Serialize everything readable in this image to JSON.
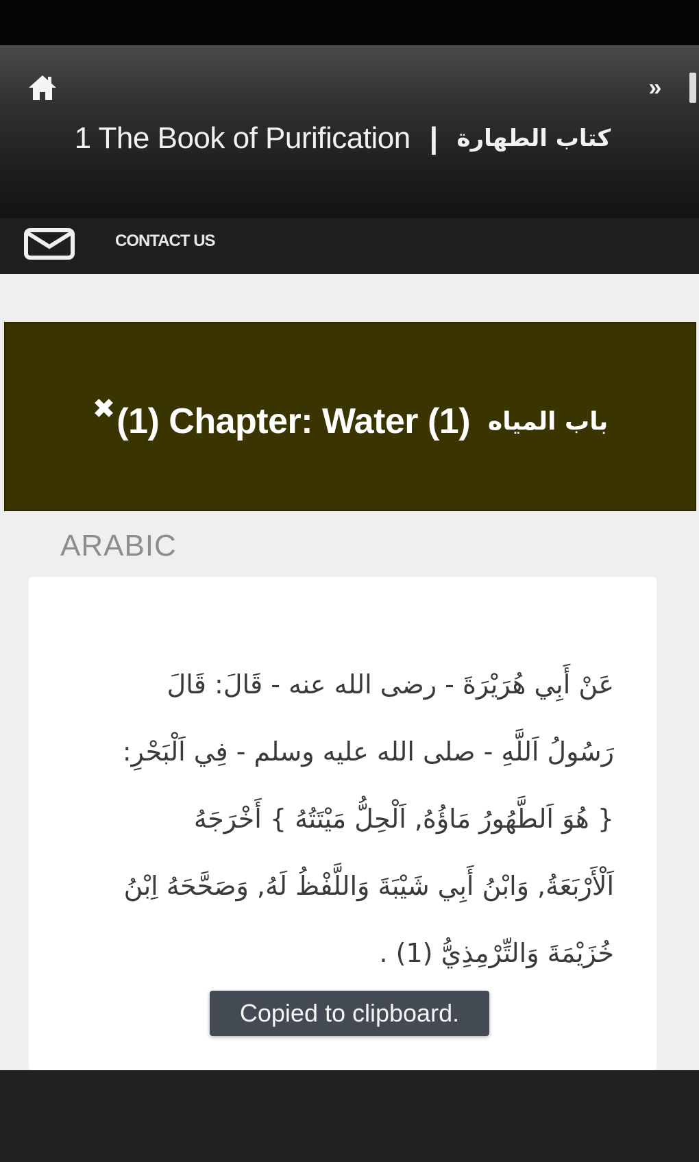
{
  "header": {
    "title_en": "1 The Book of Purification",
    "divider": "|",
    "title_ar": "كتاب الطهارة",
    "next_glyph": "»"
  },
  "contact": {
    "label": "CONTACT US"
  },
  "chapter": {
    "close_glyph": "✖",
    "title_en": "(1) Chapter: Water (1)",
    "title_ar": "باب المياه"
  },
  "section": {
    "label": "ARABIC"
  },
  "hadith": {
    "text": "عَنْ أَبِي هُرَيْرَةَ - رضى الله عنه - قَالَ: قَالَ رَسُولُ اَللَّهِ - صلى الله عليه وسلم - فِي اَلْبَحْرِ: { هُوَ اَلطَّهُورُ مَاؤُهُ, اَلْحِلُّ مَيْتَتُهُ } أَخْرَجَهُ اَلْأَرْبَعَةُ, وَابْنُ أَبِي شَيْبَةَ وَاللَّفْظُ لَهُ, وَصَحَّحَهُ اِبْنُ خُزَيْمَةَ وَالتِّرْمِذِيُّ (1) ."
  },
  "toast": {
    "message": "Copied to clipboard."
  },
  "colors": {
    "banner": "#3a3400",
    "header_dark": "#1e1e1e",
    "toast_bg": "#444a53"
  },
  "icons": {
    "home": "home-icon",
    "mail": "mail-icon",
    "close": "close-icon",
    "next": "chevron-double-right-icon"
  }
}
